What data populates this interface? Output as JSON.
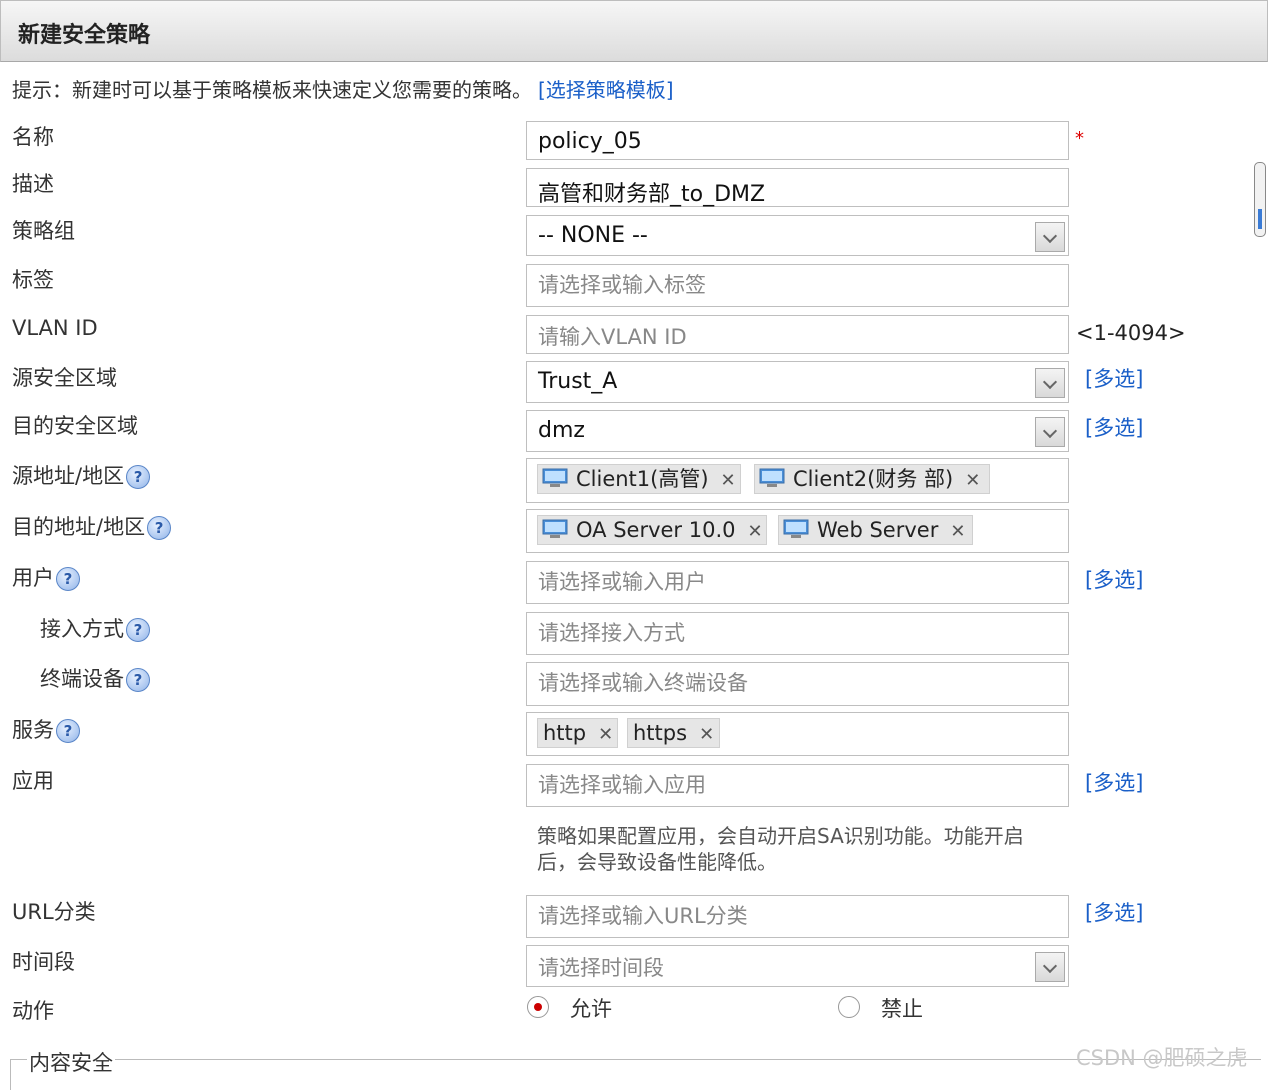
{
  "window": {
    "title": "新建安全策略"
  },
  "hint": {
    "text": "提示：新建时可以基于策略模板来快速定义您需要的策略。",
    "link": "[选择策略模板]"
  },
  "labels": {
    "name": "名称",
    "desc": "描述",
    "group": "策略组",
    "tag": "标签",
    "vlan": "VLAN ID",
    "src_zone": "源安全区域",
    "dst_zone": "目的安全区域",
    "src_addr": "源地址/地区",
    "dst_addr": "目的地址/地区",
    "user": "用户",
    "access": "接入方式",
    "terminal": "终端设备",
    "service": "服务",
    "app": "应用",
    "url": "URL分类",
    "time": "时间段",
    "action": "动作"
  },
  "fields": {
    "name_value": "policy_05",
    "desc_value": "高管和财务部_to_DMZ",
    "group_value": "-- NONE --",
    "tag_placeholder": "请选择或输入标签",
    "vlan_placeholder": "请输入VLAN ID",
    "vlan_range": "<1-4094>",
    "src_zone_value": "Trust_A",
    "dst_zone_value": "dmz",
    "src_addr_tags": [
      "Client1(高管)",
      "Client2(财务 部)"
    ],
    "dst_addr_tags": [
      "OA Server 10.0",
      "Web Server"
    ],
    "user_placeholder": "请选择或输入用户",
    "access_placeholder": "请选择接入方式",
    "terminal_placeholder": "请选择或输入终端设备",
    "service_tags": [
      "http",
      "https"
    ],
    "app_placeholder": "请选择或输入应用",
    "app_note_line1": "策略如果配置应用，会自动开启SA识别功能。功能开启",
    "app_note_line2": "后，会导致设备性能降低。",
    "url_placeholder": "请选择或输入URL分类",
    "time_placeholder": "请选择时间段"
  },
  "multi_label": "[多选]",
  "help_glyph": "?",
  "remove_glyph": "✕",
  "action": {
    "allow": "允许",
    "deny": "禁止",
    "selected": "allow"
  },
  "section": {
    "content_security": "内容安全"
  },
  "watermark": "CSDN @肥硕之虎",
  "colors": {
    "link": "#1a5fc8",
    "required": "#dd0000",
    "radio_selected": "#cc0000"
  }
}
